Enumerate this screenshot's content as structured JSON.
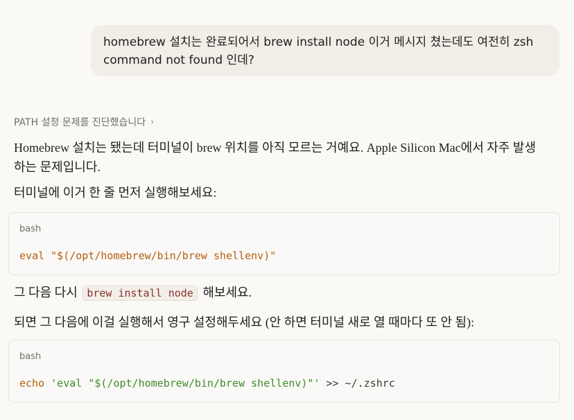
{
  "user_message": {
    "line1": "homebrew 설치는 완료되어서 brew install node 이거 메시지 쳤는데도 여전히 zsh",
    "line2": "command not found 인데?"
  },
  "thinking": {
    "label": "PATH 설정 문제를 진단했습니다",
    "chevron": "›"
  },
  "response": {
    "p1_line1": "Homebrew 설치는 됐는데 터미널이 brew 위치를 아직 모르는 거예요. Apple Silicon Mac에서 자주 발생",
    "p1_line2": "하는 문제입니다.",
    "p2": "터미널에 이거 한 줄 먼저 실행해보세요:",
    "code1": {
      "lang": "bash",
      "cmd": "eval",
      "arg": "\"$(/opt/homebrew/bin/brew shellenv)\""
    },
    "p3_before": "그 다음 다시",
    "p3_code": "brew install node",
    "p3_after": "해보세요.",
    "p4": "되면 그 다음에 이걸 실행해서 영구 설정해두세요 (안 하면 터미널 새로 열 때마다 또 안 됨):",
    "code2": {
      "lang": "bash",
      "cmd": "echo",
      "arg": "'eval \"$(/opt/homebrew/bin/brew shellenv)\"'",
      "rest": ">> ~/.zshrc"
    }
  }
}
